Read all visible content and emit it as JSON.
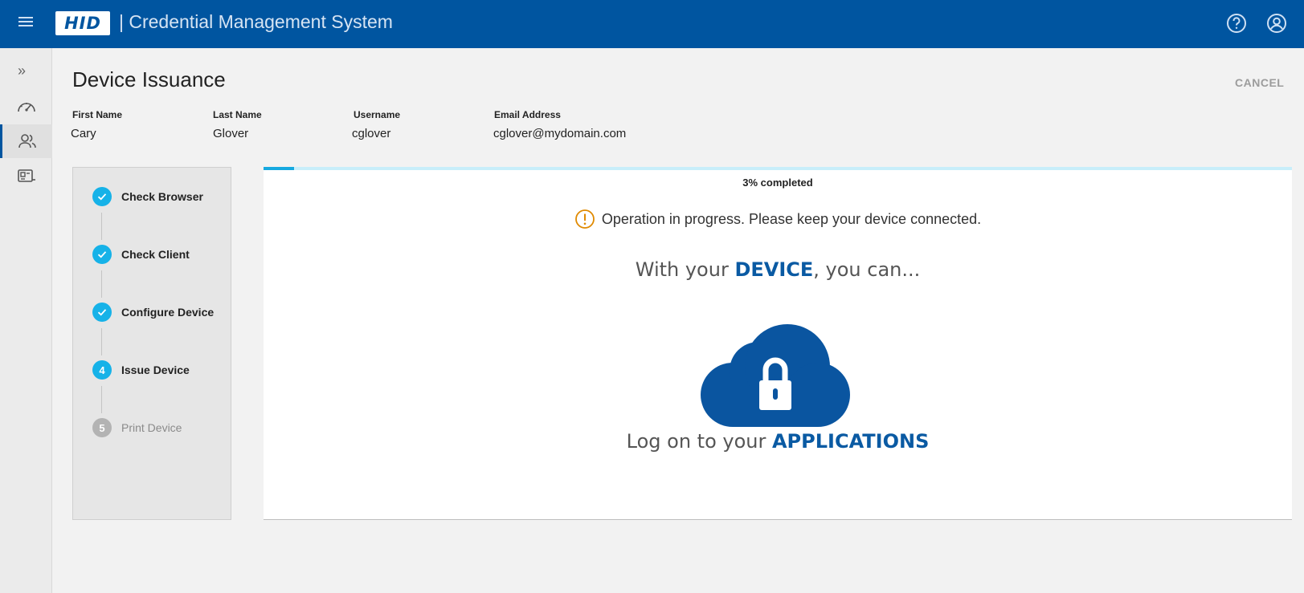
{
  "header": {
    "logo_text": "HID",
    "app_title": "| Credential Management System",
    "icons": [
      "menu-icon",
      "help-icon",
      "account-icon"
    ]
  },
  "sidenav": {
    "expand_glyph": "»",
    "items": [
      {
        "icon": "dashboard-icon",
        "active": false
      },
      {
        "icon": "users-icon",
        "active": true
      },
      {
        "icon": "credentials-icon",
        "active": false
      }
    ]
  },
  "page": {
    "title": "Device Issuance",
    "cancel_label": "CANCEL"
  },
  "user": {
    "first_name_label": "First Name",
    "first_name": "Cary",
    "last_name_label": "Last Name",
    "last_name": "Glover",
    "username_label": "Username",
    "username": "cglover",
    "email_label": "Email Address",
    "email": "cglover@mydomain.com"
  },
  "steps": [
    {
      "number": "1",
      "label": "Check Browser",
      "state": "done"
    },
    {
      "number": "2",
      "label": "Check Client",
      "state": "done"
    },
    {
      "number": "3",
      "label": "Configure Device",
      "state": "done"
    },
    {
      "number": "4",
      "label": "Issue Device",
      "state": "current"
    },
    {
      "number": "5",
      "label": "Print Device",
      "state": "pending"
    }
  ],
  "progress": {
    "percent": 3,
    "text": "3% completed",
    "status_message": "Operation in progress. Please keep your device connected."
  },
  "promo": {
    "line1_pre": "With your ",
    "line1_em": "DEVICE",
    "line1_post": ", you can...",
    "line2_pre": "Log on to your ",
    "line2_em": "APPLICATIONS",
    "graphic": "cloud-lock-icon"
  },
  "colors": {
    "header_bg": "#0055a0",
    "step_active": "#16b2e8",
    "step_pending": "#b3b3b3",
    "warning": "#e08a00",
    "emphasis": "#0a5aa3"
  }
}
